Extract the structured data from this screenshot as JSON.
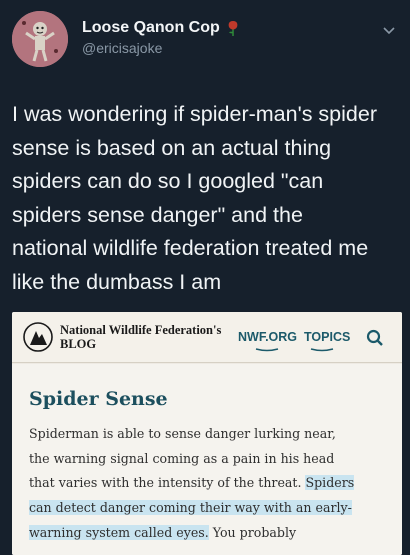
{
  "tweet": {
    "display_name": "Loose Qanon Cop",
    "emoji_icon": "rose-icon",
    "handle": "@ericisajoke",
    "lines": [
      "I was wondering if spider-man's spider",
      "sense is based on an actual thing",
      "spiders can do so I googled \"can",
      "spiders sense danger\" and the",
      "national wildlife federation treated me",
      "like the dumbass I am"
    ]
  },
  "card": {
    "site_name_line1": "National Wildlife Federation's",
    "site_name_line2": "BLOG",
    "nav_nwf": "NWF.ORG",
    "nav_topics": "TOPICS",
    "title": "Spider Sense",
    "text_lines": [
      {
        "plain": "Spiderman is able to sense danger lurking near,",
        "hl": "",
        "after": ""
      },
      {
        "plain": "the warning signal coming as a pain in his head",
        "hl": "",
        "after": ""
      },
      {
        "plain": "that varies with the intensity of the threat. ",
        "hl": "Spiders",
        "after": ""
      },
      {
        "plain": "",
        "hl": "can detect danger coming their way with an early-",
        "after": ""
      },
      {
        "plain": "",
        "hl": "warning system called eyes.",
        "after": " You probably"
      }
    ]
  },
  "colors": {
    "background": "#16202c",
    "accent_link": "#1c5a6a",
    "highlight": "#c9e4f0",
    "rose": "#c0392b"
  }
}
